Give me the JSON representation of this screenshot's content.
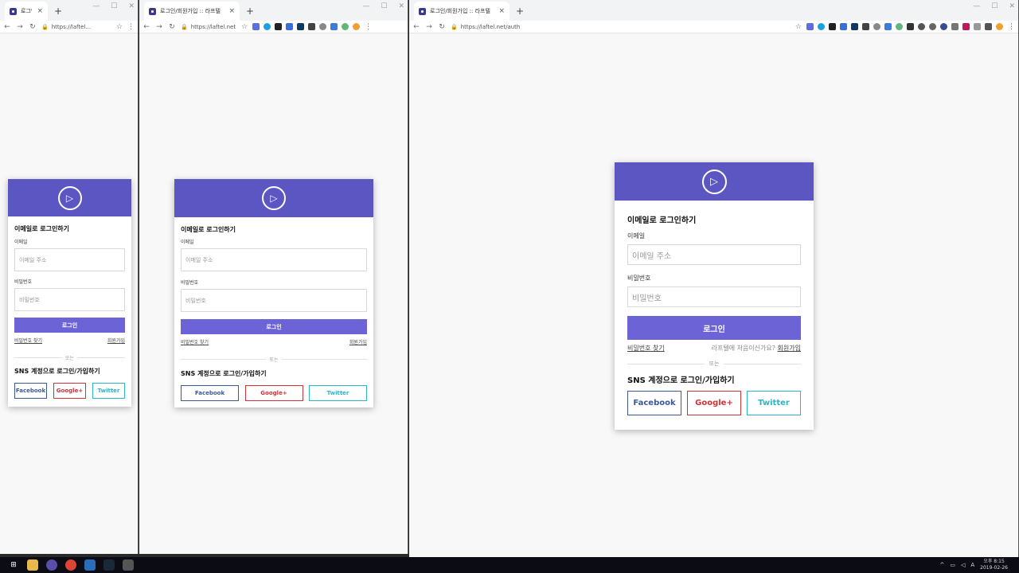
{
  "windows": [
    {
      "tab_title": "로그인/회",
      "url": "https://laftel..."
    },
    {
      "tab_title": "로그인/회원가입 :: 라프텔",
      "url": "https://laftel.net..."
    },
    {
      "tab_title": "로그인/회원가입 :: 라프텔",
      "url": "https://laftel.net/auth"
    }
  ],
  "form": {
    "heading": "이메일로 로그인하기",
    "email_label": "이메일",
    "email_placeholder": "이메일 주소",
    "password_label": "비밀번호",
    "password_placeholder": "비밀번호",
    "login_button": "로그인",
    "find_password": "비밀번호 찾기",
    "signup": "회원가입",
    "first_time": "라프텔에 처음이신가요?",
    "or": "또는",
    "sns_heading": "SNS 계정으로 로그인/가입하기",
    "facebook": "Facebook",
    "google": "Google+",
    "twitter": "Twitter"
  },
  "taskbar": {
    "clock_ampm": "오후 8:15",
    "clock_date": "2019-02-26"
  },
  "colors": {
    "brand": "#5c56c2",
    "button": "#6c63d6",
    "facebook": "#3b5998",
    "google": "#d0323a",
    "twitter": "#2cb5c6"
  }
}
